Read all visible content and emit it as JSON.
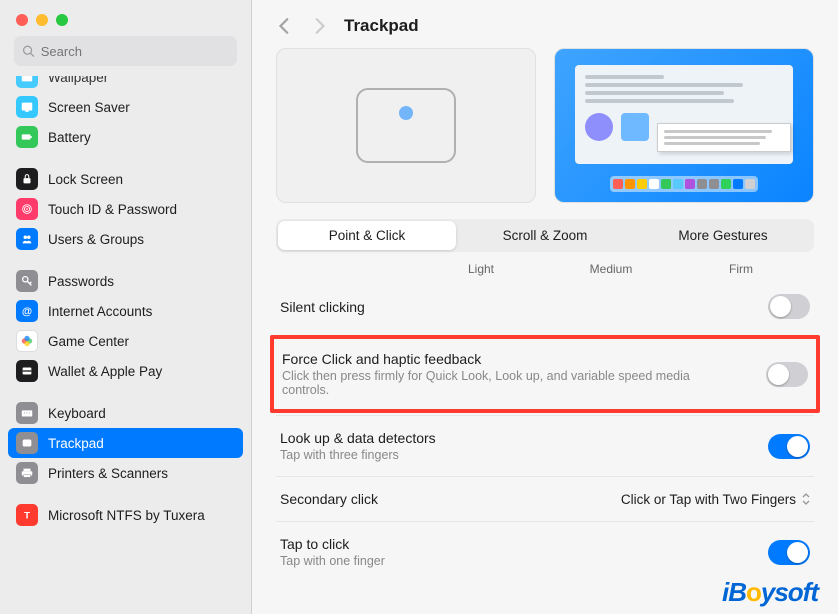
{
  "header": {
    "title": "Trackpad"
  },
  "search": {
    "placeholder": "Search"
  },
  "sidebar": {
    "items": [
      {
        "label": "Wallpaper",
        "color": "#34c8ff",
        "glyph": "wallpaper"
      },
      {
        "label": "Screen Saver",
        "color": "#34c8ff",
        "glyph": "screensaver"
      },
      {
        "label": "Battery",
        "color": "#34c759",
        "glyph": "battery"
      },
      {
        "spacer": true
      },
      {
        "label": "Lock Screen",
        "color": "#1d1d1f",
        "glyph": "lock"
      },
      {
        "label": "Touch ID & Password",
        "color": "#ff3b6b",
        "glyph": "fingerprint"
      },
      {
        "label": "Users & Groups",
        "color": "#007aff",
        "glyph": "users"
      },
      {
        "spacer": true
      },
      {
        "label": "Passwords",
        "color": "#8e8e93",
        "glyph": "key"
      },
      {
        "label": "Internet Accounts",
        "color": "#007aff",
        "glyph": "at"
      },
      {
        "label": "Game Center",
        "color": "#ffffff",
        "glyph": "gamecenter",
        "border": true
      },
      {
        "label": "Wallet & Apple Pay",
        "color": "#1d1d1f",
        "glyph": "wallet"
      },
      {
        "spacer": true
      },
      {
        "label": "Keyboard",
        "color": "#8e8e93",
        "glyph": "keyboard"
      },
      {
        "label": "Trackpad",
        "color": "#8e8e93",
        "glyph": "trackpad",
        "active": true
      },
      {
        "label": "Printers & Scanners",
        "color": "#8e8e93",
        "glyph": "printer"
      },
      {
        "spacer": true
      },
      {
        "label": "Microsoft NTFS by Tuxera",
        "color": "#ff3b30",
        "glyph": "ntfs"
      }
    ]
  },
  "tabs": [
    {
      "label": "Point & Click",
      "selected": true
    },
    {
      "label": "Scroll & Zoom",
      "selected": false
    },
    {
      "label": "More Gestures",
      "selected": false
    }
  ],
  "slider_labels": [
    "Light",
    "Medium",
    "Firm"
  ],
  "settings": [
    {
      "title": "Silent clicking",
      "sub": "",
      "type": "toggle",
      "on": false,
      "highlight": false
    },
    {
      "title": "Force Click and haptic feedback",
      "sub": "Click then press firmly for Quick Look, Look up, and variable speed media controls.",
      "type": "toggle",
      "on": false,
      "highlight": true
    },
    {
      "title": "Look up & data detectors",
      "sub": "Tap with three fingers",
      "type": "toggle",
      "on": true,
      "highlight": false
    },
    {
      "title": "Secondary click",
      "sub": "",
      "type": "dropdown",
      "value": "Click or Tap with Two Fingers",
      "highlight": false
    },
    {
      "title": "Tap to click",
      "sub": "Tap with one finger",
      "type": "toggle",
      "on": true,
      "highlight": false
    }
  ],
  "dock_colors": [
    "#ff5f57",
    "#ff9500",
    "#ffcc00",
    "#ffffff",
    "#34c759",
    "#5ac8fa",
    "#af52de",
    "#8e8e93",
    "#8e8e93",
    "#30d158",
    "#007aff",
    "#d0d0d0"
  ],
  "watermark": "iBoysoft"
}
